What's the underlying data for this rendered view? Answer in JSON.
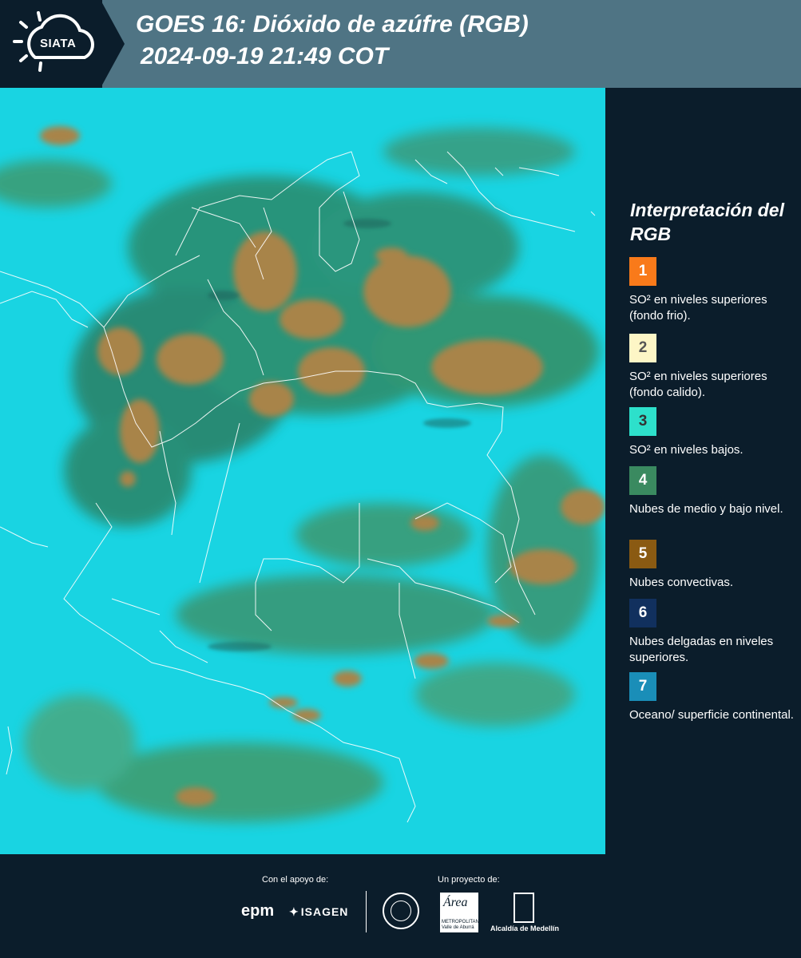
{
  "header": {
    "logo_text": "SIATA",
    "title_line1": "GOES 16: Dióxido de azúfre (RGB)",
    "title_line2": "2024-09-19 21:49 COT"
  },
  "legend": {
    "title": "Interpretación del RGB",
    "items": [
      {
        "num": "1",
        "color": "#f97a1a",
        "text": "SO² en niveles superiores (fondo frio)."
      },
      {
        "num": "2",
        "color": "#fdf6c6",
        "text": "SO² en niveles superiores (fondo calido)."
      },
      {
        "num": "3",
        "color": "#2de0cb",
        "text": "SO² en niveles bajos."
      },
      {
        "num": "4",
        "color": "#3a8a60",
        "text": "Nubes de medio y bajo nivel."
      },
      {
        "num": "5",
        "color": "#8a5a12",
        "text": "Nubes convectivas."
      },
      {
        "num": "6",
        "color": "#11305e",
        "text": "Nubes delgadas en niveles superiores."
      },
      {
        "num": "7",
        "color": "#1a8eb8",
        "text": "Oceano/ superficie continental."
      }
    ]
  },
  "footer": {
    "support_label": "Con el apoyo de:",
    "project_label": "Un proyecto de:",
    "epm": "epm",
    "isagen": "ISAGEN",
    "area_name": "Área",
    "area_sub": "METROPOLITANA Valle de Aburrá",
    "alcaldia": "Alcaldía de Medellín"
  },
  "colors": {
    "background": "#0b1d2b",
    "header_bar": "#4f7484",
    "map_base": "#19d2e0",
    "cloud_green": "#2f8a63",
    "convective": "#a88446"
  }
}
